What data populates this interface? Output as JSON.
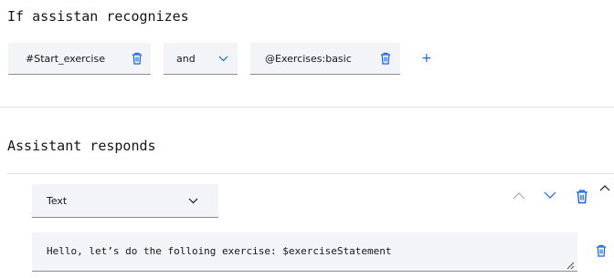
{
  "condition": {
    "heading": "If assistan recognizes",
    "intent_chip": "#Start_exercise",
    "operator": "and",
    "entity_chip": "@Exercises:basic",
    "add_label": "+"
  },
  "response": {
    "heading": "Assistant responds",
    "type_select": "Text",
    "text_value": "Hello, let’s do the folloing exercise: $exerciseStatement"
  },
  "colors": {
    "accent": "#0f62fe",
    "field_bg": "#f2f4f8",
    "icon_grey": "#a8a8a8"
  }
}
